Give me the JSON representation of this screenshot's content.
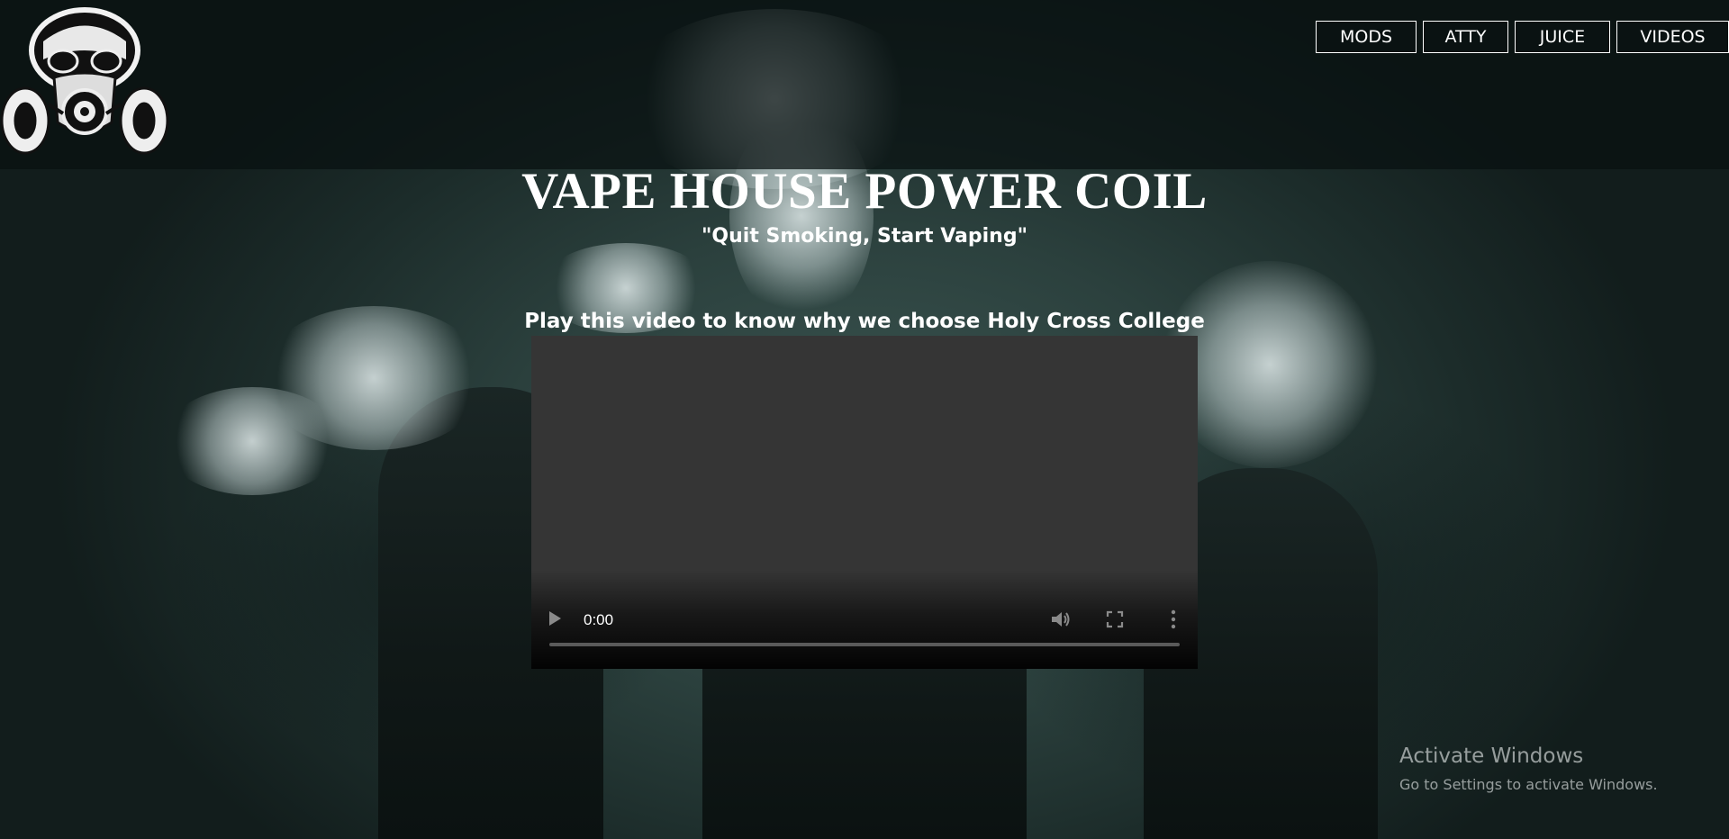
{
  "nav": {
    "items": [
      {
        "label": "MODS"
      },
      {
        "label": "ATTY"
      },
      {
        "label": "JUICE"
      },
      {
        "label": "VIDEOS"
      }
    ]
  },
  "logo": {
    "icon": "gas-mask-skull-icon"
  },
  "hero": {
    "title": "VAPE HOUSE POWER COIL",
    "tagline": "\"Quit Smoking, Start Vaping\""
  },
  "video": {
    "caption": "Play this video to know why we choose Holy Cross College",
    "current_time": "0:00",
    "progress": 0,
    "icons": {
      "play": "play-icon",
      "volume": "volume-icon",
      "fullscreen": "fullscreen-icon",
      "more": "more-options-icon"
    }
  },
  "watermark": {
    "title": "Activate Windows",
    "subtitle": "Go to Settings to activate Windows."
  },
  "colors": {
    "background": "#2b403d",
    "header": "#0a1313",
    "video_bg": "#353535",
    "text": "#ffffff"
  }
}
